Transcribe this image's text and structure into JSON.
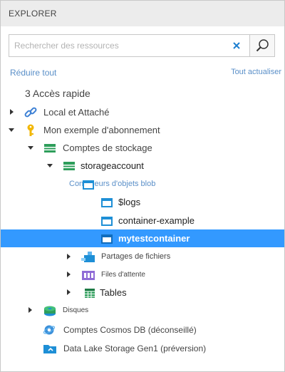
{
  "header": {
    "title": "EXPLORER"
  },
  "search": {
    "placeholder": "Rechercher des ressources",
    "value": ""
  },
  "actions": {
    "collapse_all": "Réduire tout",
    "refresh_all": "Tout actualiser"
  },
  "tree": {
    "quick_access": "3 Accès rapide",
    "local_attached": "Local et  Attaché",
    "subscription": "Mon exemple d'abonnement",
    "storage_accounts": "Comptes de stockage",
    "storage_account": "storageaccount",
    "blob_containers": "Conteneurs d'objets blob",
    "containers": [
      "$logs",
      "container-example",
      "mytestcontainer"
    ],
    "file_shares": "Partages de fichiers",
    "queues": "Files d'attente",
    "tables": "Tables",
    "disks": "Disques",
    "cosmos": "Comptes Cosmos DB (déconseillé)",
    "datalake": "Data Lake Storage Gen1  (préversion)"
  },
  "colors": {
    "selection": "#3399ff",
    "link": "#5a8fc8",
    "storage_green": "#2e9e5b",
    "container_blue": "#1e8fd6"
  }
}
